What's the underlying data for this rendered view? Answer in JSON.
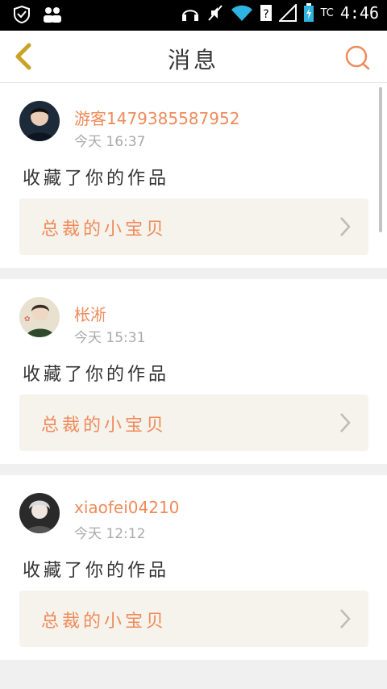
{
  "status_bar": {
    "time": "4:46",
    "network": "TC",
    "icons": [
      "shield-icon",
      "people-icon",
      "headphones-icon",
      "mute-icon",
      "wifi-icon",
      "signal-icon",
      "battery-icon"
    ]
  },
  "header": {
    "title": "消息",
    "back_icon": "chevron-left-icon",
    "search_icon": "search-icon"
  },
  "colors": {
    "accent": "#f08a5a",
    "card_inner": "#f5f3ec",
    "back": "#c9a227"
  },
  "messages": [
    {
      "name": "游客1479385587952",
      "time": "今天 16:37",
      "action": "收藏了你的作品",
      "work_title": "总裁的小宝贝"
    },
    {
      "name": "枨淅",
      "time": "今天 15:31",
      "action": "收藏了你的作品",
      "work_title": "总裁的小宝贝"
    },
    {
      "name": "xiaofei04210",
      "time": "今天 12:12",
      "action": "收藏了你的作品",
      "work_title": "总裁的小宝贝"
    }
  ]
}
